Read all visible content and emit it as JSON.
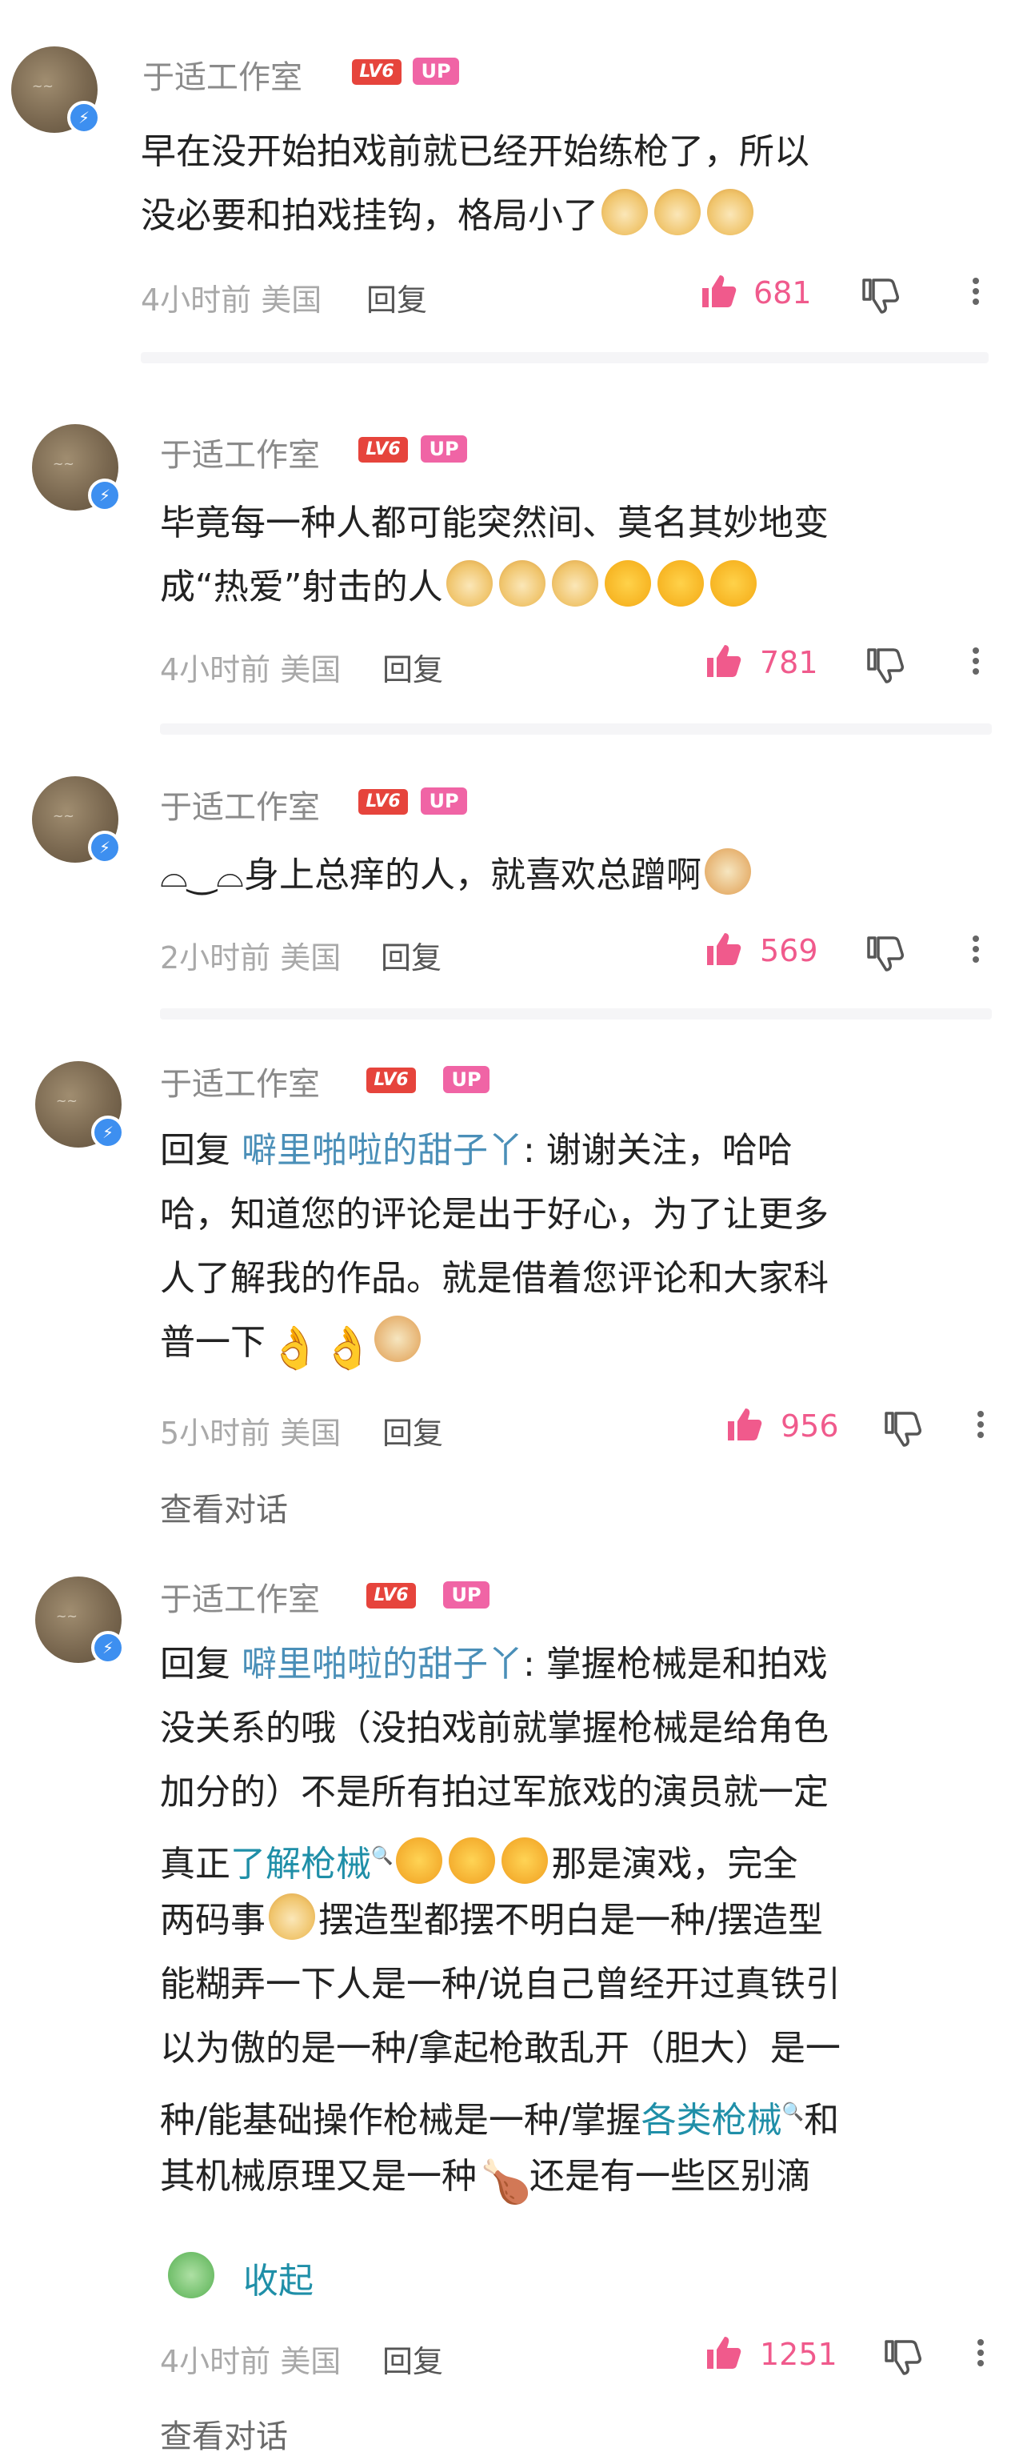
{
  "comments": [
    {
      "author": "于适工作室",
      "level": "LV6",
      "up_badge": "UP",
      "lines": [
        "早在没开始拍戏前就已经开始练枪了，所以",
        "没必要和拍戏挂钩，格局小了"
      ],
      "time": "4小时前",
      "location": "美国",
      "reply_label": "回复",
      "likes": "681"
    },
    {
      "author": "于适工作室",
      "level": "LV6",
      "up_badge": "UP",
      "lines": [
        "毕竟每一种人都可能突然间、莫名其妙地变",
        "成“热爱”射击的人"
      ],
      "time": "4小时前",
      "location": "美国",
      "reply_label": "回复",
      "likes": "781"
    },
    {
      "author": "于适工作室",
      "level": "LV6",
      "up_badge": "UP",
      "lines": [
        "⌓‿⌓身上总痒的人，就喜欢总蹭啊"
      ],
      "time": "2小时前",
      "location": "美国",
      "reply_label": "回复",
      "likes": "569"
    },
    {
      "author": "于适工作室",
      "level": "LV6",
      "up_badge": "UP",
      "reply_prefix": "回复",
      "reply_to": "噼里啪啦的甜子丫",
      "lines": [
        ": 谢谢关注，哈哈",
        "哈，知道您的评论是出于好心，为了让更多",
        "人了解我的作品。就是借着您评论和大家科",
        "普一下"
      ],
      "time": "5小时前",
      "location": "美国",
      "reply_label": "回复",
      "likes": "956",
      "view_conversation": "查看对话"
    },
    {
      "author": "于适工作室",
      "level": "LV6",
      "up_badge": "UP",
      "reply_prefix": "回复",
      "reply_to": "噼里啪啦的甜子丫",
      "lines": [
        ": 掌握枪械是和拍戏",
        "没关系的哦（没拍戏前就掌握枪械是给角色",
        "加分的）不是所有拍过军旅戏的演员就一定",
        "真正",
        "两码事",
        "能糊弄一下人是一种/说自己曾经开过真铁引",
        "以为傲的是一种/拿起枪敢乱开（胆大）是一",
        "种/能基础操作枪械是一种/掌握",
        "其机械原理又是一种"
      ],
      "link1": "了解枪械",
      "after_link1": "那是演戏，完全",
      "after_line5": "摆造型都摆不明白是一种/摆造型",
      "link2": "各类枪械",
      "after_link2": "和",
      "after_line9": "还是有一些区别滴",
      "collapse_label": "收起",
      "time": "4小时前",
      "location": "美国",
      "reply_label": "回复",
      "likes": "1251",
      "view_conversation": "查看对话"
    }
  ],
  "icons": {
    "like": "thumbs-up-icon",
    "dislike": "thumbs-down-icon",
    "more": "more-vertical-icon",
    "verified": "lightning-badge-icon"
  },
  "colors": {
    "like_pink": "#f05a8c",
    "link_teal": "#1f8fa8",
    "level_red": "#e6443c",
    "up_pink": "#f064a5"
  }
}
